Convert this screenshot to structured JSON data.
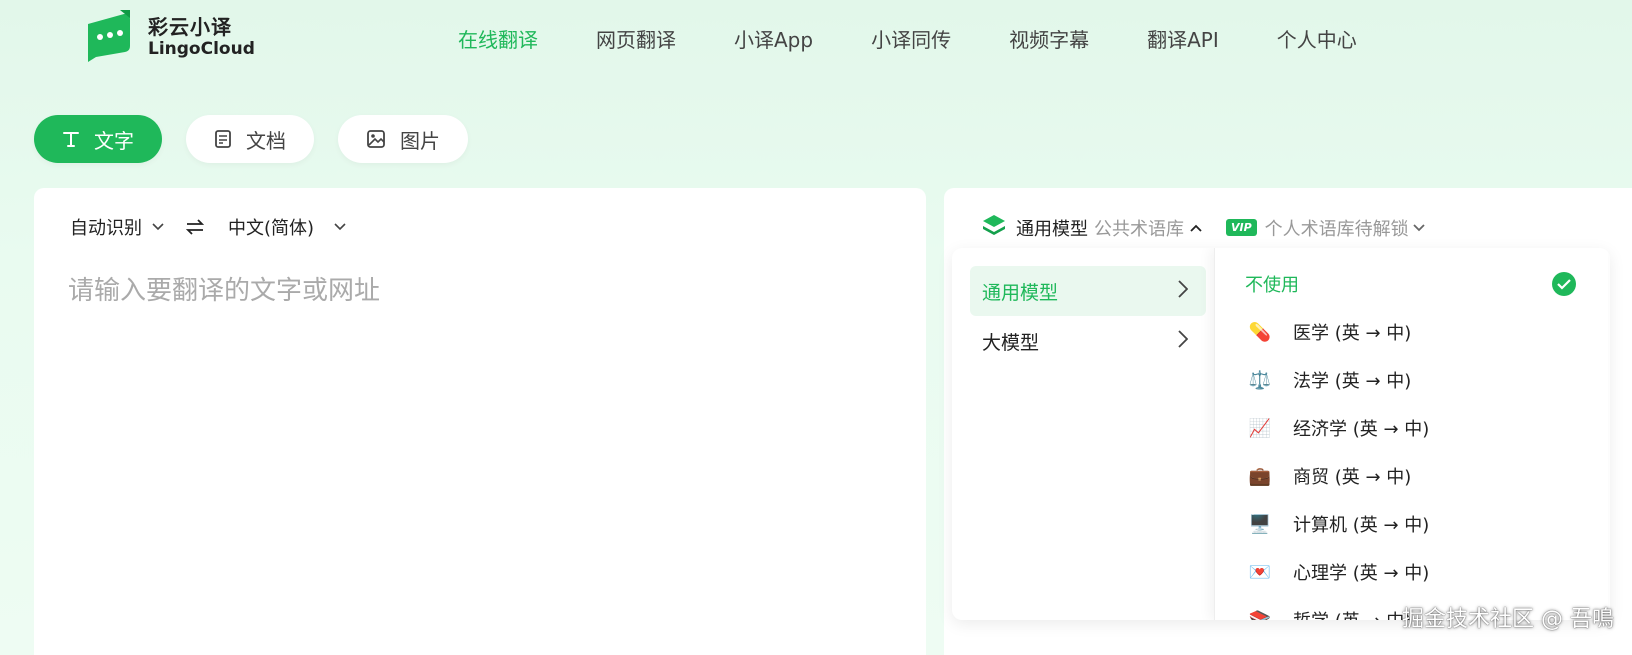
{
  "brand": {
    "name_cn": "彩云小译",
    "name_en": "LingoCloud",
    "color": "#1fb85a"
  },
  "nav": {
    "items": [
      {
        "label": "在线翻译",
        "active": true
      },
      {
        "label": "网页翻译"
      },
      {
        "label": "小译App"
      },
      {
        "label": "小译同传"
      },
      {
        "label": "视频字幕"
      },
      {
        "label": "翻译API"
      },
      {
        "label": "个人中心"
      }
    ]
  },
  "modes": [
    {
      "label": "文字",
      "icon": "text-icon",
      "active": true
    },
    {
      "label": "文档",
      "icon": "document-icon"
    },
    {
      "label": "图片",
      "icon": "image-icon"
    }
  ],
  "source": {
    "from_lang": "自动识别",
    "to_lang": "中文(简体)",
    "placeholder": "请输入要翻译的文字或网址"
  },
  "model_bar": {
    "model": "通用模型",
    "terms": "公共术语库",
    "vip_badge": "VIP",
    "personal_terms": "个人术语库待解锁"
  },
  "dropdown": {
    "categories": [
      {
        "label": "通用模型",
        "active": true
      },
      {
        "label": "大模型"
      }
    ],
    "domains": [
      {
        "label": "不使用",
        "active": true
      },
      {
        "label": "医学 (英 → 中)",
        "icon": "💊"
      },
      {
        "label": "法学 (英 → 中)",
        "icon": "⚖️"
      },
      {
        "label": "经济学 (英 → 中)",
        "icon": "📈"
      },
      {
        "label": "商贸 (英 → 中)",
        "icon": "💼"
      },
      {
        "label": "计算机 (英 → 中)",
        "icon": "🖥️"
      },
      {
        "label": "心理学 (英 → 中)",
        "icon": "💌"
      },
      {
        "label": "哲学 (英 → 中)",
        "icon": "📚"
      }
    ]
  },
  "watermark": "掘金技术社区 @ 吾鳴"
}
